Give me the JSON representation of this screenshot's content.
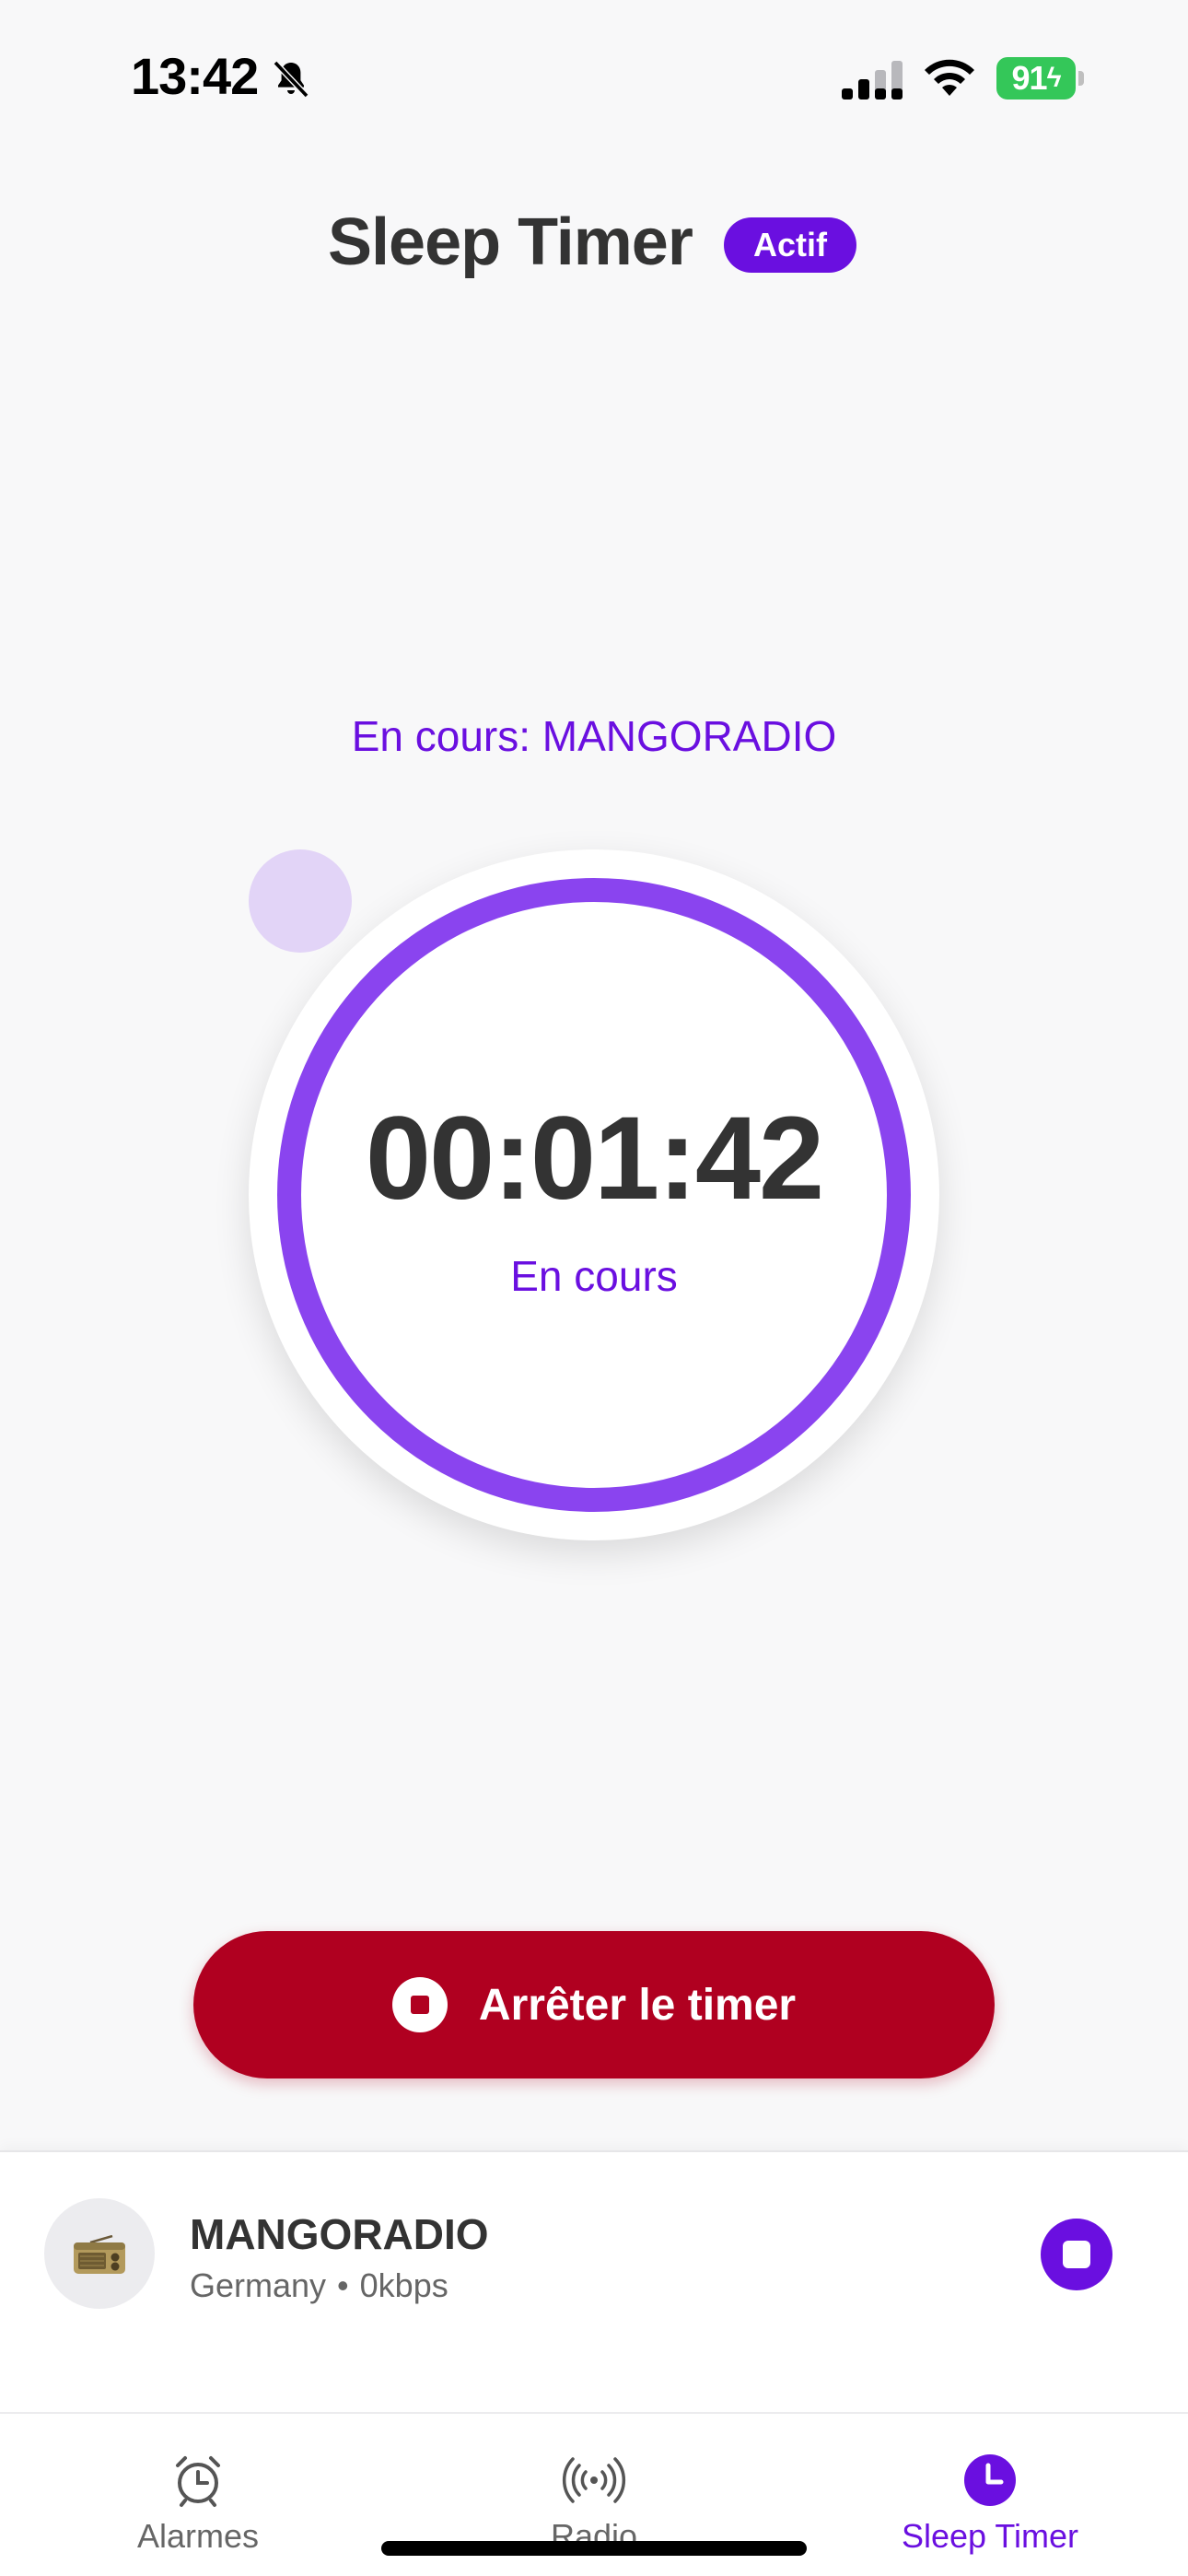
{
  "status_bar": {
    "time": "13:42",
    "battery": "91",
    "icons": [
      "bell-slash-icon",
      "cellular-signal-icon",
      "wifi-icon",
      "battery-charging-icon"
    ]
  },
  "header": {
    "title": "Sleep Timer",
    "badge": "Actif"
  },
  "now_playing": "En cours: MANGORADIO",
  "timer": {
    "remaining": "00:01:42",
    "status": "En cours"
  },
  "stop_button": {
    "label": "Arrêter le timer",
    "icon": "stop-circle-icon"
  },
  "mini_player": {
    "station": "MANGORADIO",
    "country": "Germany",
    "separator": "•",
    "bitrate": "0kbps",
    "logo_icon": "radio-icon",
    "control_icon": "stop-icon"
  },
  "tabs": [
    {
      "label": "Alarmes",
      "icon": "alarm-clock-icon",
      "active": false
    },
    {
      "label": "Radio",
      "icon": "broadcast-icon",
      "active": false
    },
    {
      "label": "Sleep Timer",
      "icon": "clock-icon",
      "active": true
    }
  ],
  "colors": {
    "accent": "#6a0fe0",
    "ring": "#8a44ef",
    "danger": "#b00020",
    "battery": "#34c759",
    "background": "#f8f8f9"
  }
}
